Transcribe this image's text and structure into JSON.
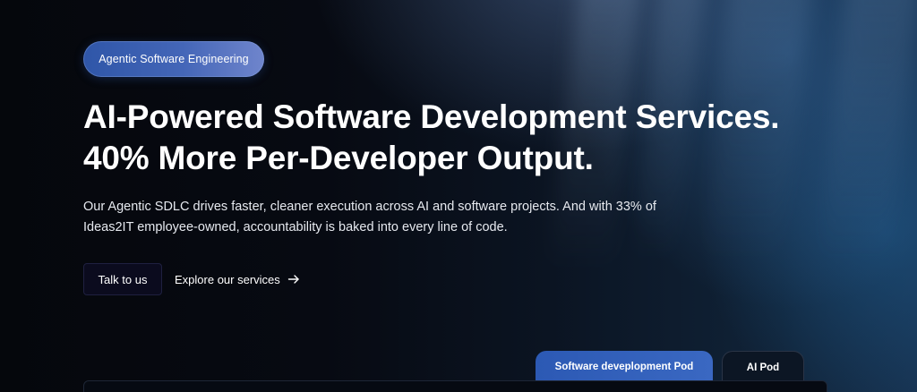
{
  "badge": {
    "label": "Agentic Software Engineering"
  },
  "hero": {
    "headline_line1": "AI-Powered Software Development Services.",
    "headline_line2": "40% More Per-Developer Output.",
    "description_line1": "Our Agentic SDLC drives faster, cleaner execution across AI and software projects. And with 33% of",
    "description_line2": "Ideas2IT employee-owned, accountability is baked into every line of code."
  },
  "cta": {
    "primary_label": "Talk to us",
    "secondary_label": "Explore our services",
    "secondary_icon": "arrow-right-icon"
  },
  "tabs": [
    {
      "label": "Software deveplopment Pod",
      "active": true
    },
    {
      "label": "AI Pod",
      "active": false
    }
  ],
  "colors": {
    "background": "#05070d",
    "badge_gradient_start": "#2f56a8",
    "badge_gradient_end": "#6f85cc",
    "primary_button_bg": "#0b0b1e",
    "active_tab": "#2c59b4",
    "text": "#ffffff"
  }
}
